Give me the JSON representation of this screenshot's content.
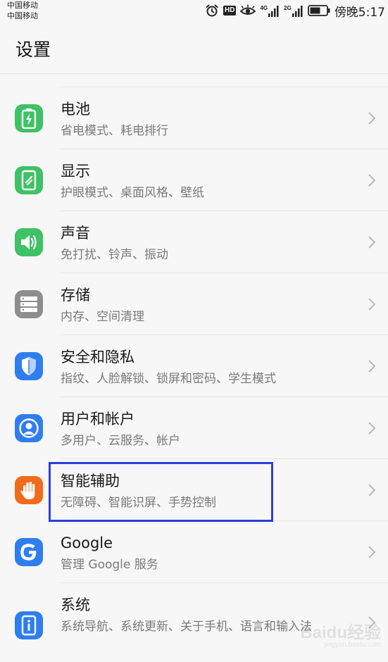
{
  "status_bar": {
    "carrier_1": "中国移动",
    "carrier_2": "中国移动",
    "hd_label": "HD",
    "network_1": "4G",
    "network_2": "2G",
    "time": "傍晚5:17",
    "icons": [
      "alarm-icon",
      "hd-icon",
      "eye-comfort-icon",
      "signal-icon",
      "battery-icon"
    ]
  },
  "header": {
    "title": "设置"
  },
  "colors": {
    "battery": "#3fc165",
    "display": "#3fc165",
    "sound": "#3fc165",
    "storage": "#8e8e8e",
    "security": "#2f7ef0",
    "users": "#2f7ef0",
    "assist": "#f26a1b",
    "google": "#2f7ef0",
    "system": "#2f7ef0",
    "highlight": "#2b3fd6"
  },
  "settings": {
    "items": [
      {
        "title": "电池",
        "subtitle": "省电模式、耗电排行",
        "icon": "battery-icon"
      },
      {
        "title": "显示",
        "subtitle": "护眼模式、桌面风格、壁纸",
        "icon": "display-icon"
      },
      {
        "title": "声音",
        "subtitle": "免打扰、铃声、振动",
        "icon": "speaker-icon"
      },
      {
        "title": "存储",
        "subtitle": "内存、空间清理",
        "icon": "storage-icon"
      },
      {
        "title": "安全和隐私",
        "subtitle": "指纹、人脸解锁、锁屏和密码、学生模式",
        "icon": "shield-icon"
      },
      {
        "title": "用户和帐户",
        "subtitle": "多用户、云服务、帐户",
        "icon": "user-icon"
      },
      {
        "title": "智能辅助",
        "subtitle": "无障碍、智能识屏、手势控制",
        "icon": "hand-icon"
      },
      {
        "title": "Google",
        "subtitle": "管理 Google 服务",
        "icon": "google-icon"
      },
      {
        "title": "系统",
        "subtitle": "系统导航、系统更新、关于手机、语言和输入法",
        "icon": "system-info-icon"
      }
    ]
  },
  "watermark": {
    "brand": "Baidu经验",
    "url": "jingyan.baidu.com"
  }
}
